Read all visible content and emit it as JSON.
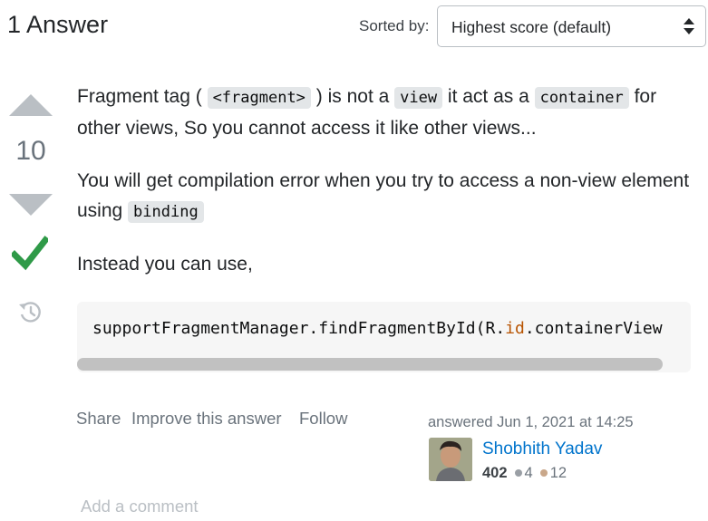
{
  "header": {
    "answers_count": "1 Answer",
    "sort_label": "Sorted by:",
    "sort_value": "Highest score (default)"
  },
  "votes": {
    "count": "10",
    "accepted": true
  },
  "answer": {
    "p1": {
      "before": "Fragment tag ( ",
      "code1": "<fragment>",
      "mid1": " ) is not a ",
      "code2": "view",
      "mid2": " it act as a ",
      "code3": "container",
      "after": " for other views, So you cannot access it like other views..."
    },
    "p2": {
      "before": "You will get compilation error when you try to access a non-view element using ",
      "code": "binding"
    },
    "p3": "Instead you can use,",
    "code_block": {
      "before": "supportFragmentManager.findFragmentById(R.",
      "id_token": "id",
      "after": ".containerView"
    }
  },
  "actions": {
    "share": "Share",
    "improve": "Improve this answer",
    "follow": "Follow"
  },
  "author": {
    "answered": "answered Jun 1, 2021 at 14:25",
    "name": "Shobhith Yadav",
    "reputation": "402",
    "silver": "4",
    "bronze": "12"
  },
  "comments": {
    "add_label": "Add a comment"
  },
  "colors": {
    "link": "#0074cc",
    "accepted": "#2f9a48",
    "vote_arrow": "#babfc4",
    "code_token": "#b75301"
  }
}
